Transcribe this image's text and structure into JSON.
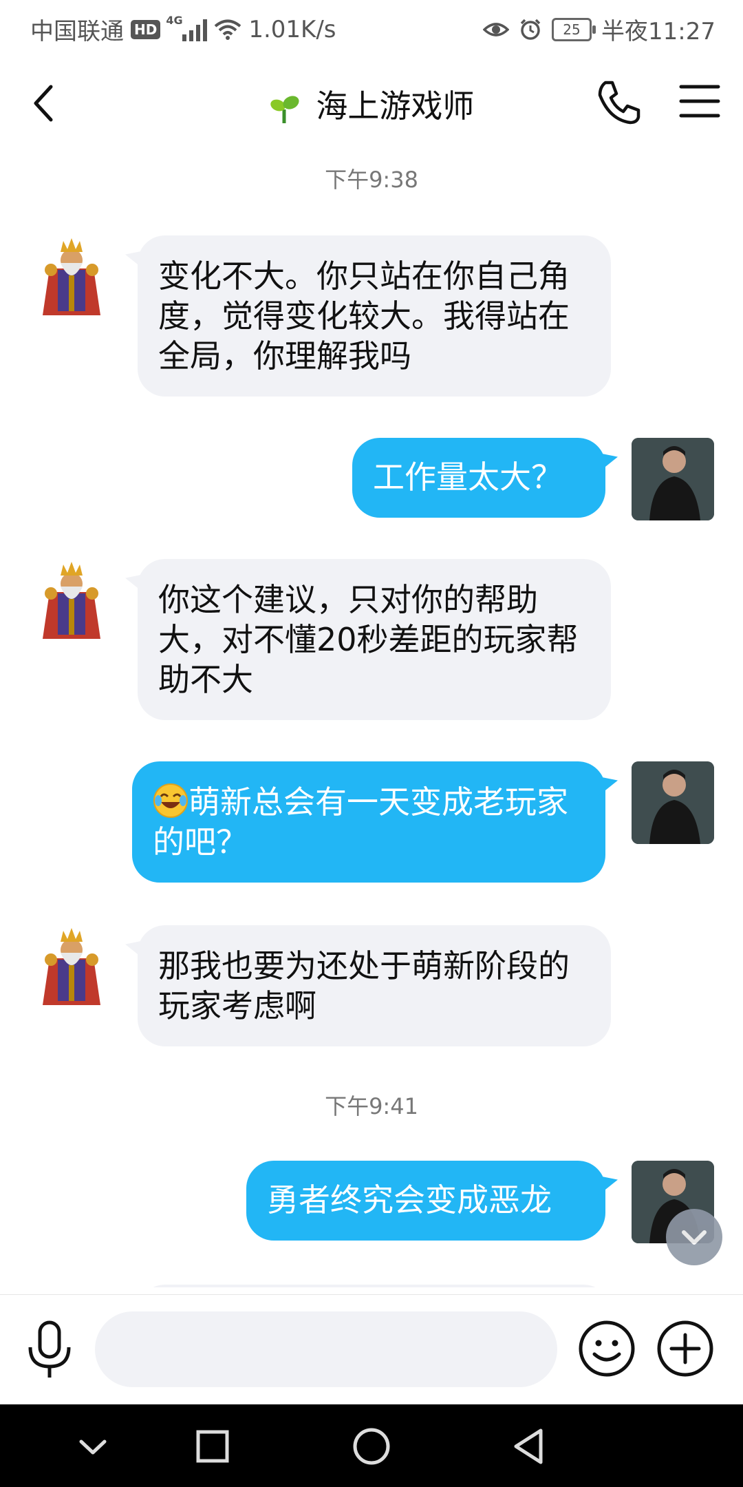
{
  "status_bar": {
    "carrier": "中国联通",
    "hd_badge": "HD",
    "network_type": "4G",
    "speed": "1.01K/s",
    "battery_level": "25",
    "time": "半夜11:27"
  },
  "header": {
    "title": "海上游戏师"
  },
  "messages": [
    {
      "type": "timestamp",
      "text": "下午9:38"
    },
    {
      "side": "left",
      "text": "变化不大。你只站在你自己角度，觉得变化较大。我得站在全局，你理解我吗"
    },
    {
      "side": "right",
      "text": "工作量太大？"
    },
    {
      "side": "left",
      "text": "你这个建议，只对你的帮助大，对不懂20秒差距的玩家帮助不大"
    },
    {
      "side": "right",
      "emoji": "laughing-crying-emoji",
      "text": "萌新总会有一天变成老玩家的吧？"
    },
    {
      "side": "left",
      "text": "那我也要为还处于萌新阶段的玩家考虑啊"
    },
    {
      "type": "timestamp",
      "text": "下午9:41"
    },
    {
      "side": "right",
      "text": "勇者终究会变成恶龙"
    }
  ],
  "input": {
    "placeholder": "",
    "value": ""
  },
  "colors": {
    "outgoing_bubble": "#22b6f5",
    "incoming_bubble": "#f1f2f6",
    "background": "#ffffff"
  }
}
